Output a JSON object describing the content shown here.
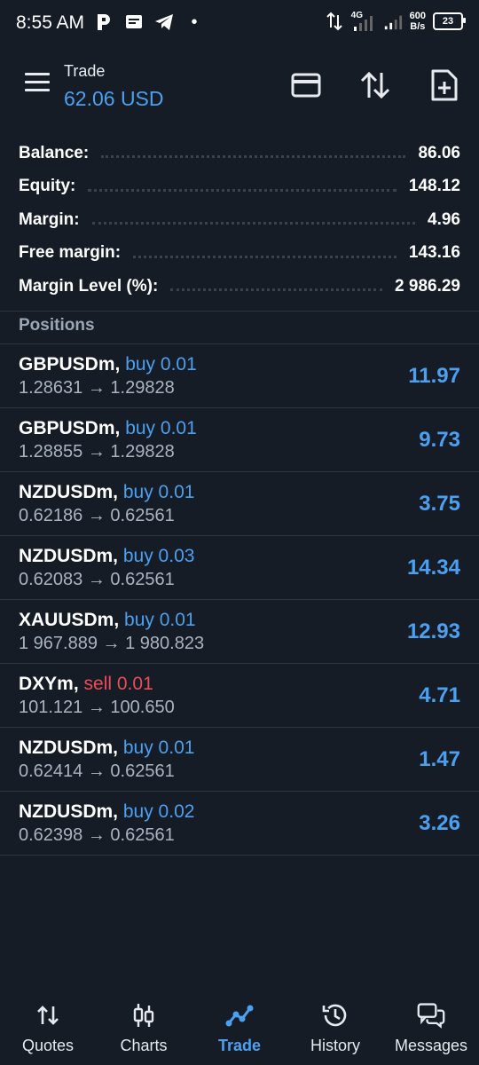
{
  "status_bar": {
    "time": "8:55 AM",
    "network_type": "4G",
    "speed_value": "600",
    "speed_unit": "B/s",
    "battery": "23",
    "dot": "•"
  },
  "header": {
    "title": "Trade",
    "subtitle": "62.06 USD"
  },
  "summary": [
    {
      "label": "Balance:",
      "value": "86.06"
    },
    {
      "label": "Equity:",
      "value": "148.12"
    },
    {
      "label": "Margin:",
      "value": "4.96"
    },
    {
      "label": "Free margin:",
      "value": "143.16"
    },
    {
      "label": "Margin Level (%):",
      "value": "2 986.29"
    }
  ],
  "positions_label": "Positions",
  "positions": [
    {
      "symbol": "GBPUSDm,",
      "side": "buy 0.01",
      "open": "1.28631",
      "arrow": "→",
      "current": "1.29828",
      "profit": "11.97",
      "type": "buy"
    },
    {
      "symbol": "GBPUSDm,",
      "side": "buy 0.01",
      "open": "1.28855",
      "arrow": "→",
      "current": "1.29828",
      "profit": "9.73",
      "type": "buy"
    },
    {
      "symbol": "NZDUSDm,",
      "side": "buy 0.01",
      "open": "0.62186",
      "arrow": "→",
      "current": "0.62561",
      "profit": "3.75",
      "type": "buy"
    },
    {
      "symbol": "NZDUSDm,",
      "side": "buy 0.03",
      "open": "0.62083",
      "arrow": "→",
      "current": "0.62561",
      "profit": "14.34",
      "type": "buy"
    },
    {
      "symbol": "XAUUSDm,",
      "side": "buy 0.01",
      "open": "1 967.889",
      "arrow": "→",
      "current": "1 980.823",
      "profit": "12.93",
      "type": "buy"
    },
    {
      "symbol": "DXYm,",
      "side": "sell 0.01",
      "open": "101.121",
      "arrow": "→",
      "current": "100.650",
      "profit": "4.71",
      "type": "sell"
    },
    {
      "symbol": "NZDUSDm,",
      "side": "buy 0.01",
      "open": "0.62414",
      "arrow": "→",
      "current": "0.62561",
      "profit": "1.47",
      "type": "buy"
    },
    {
      "symbol": "NZDUSDm,",
      "side": "buy 0.02",
      "open": "0.62398",
      "arrow": "→",
      "current": "0.62561",
      "profit": "3.26",
      "type": "buy"
    }
  ],
  "nav": [
    {
      "label": "Quotes",
      "icon": "quotes-icon"
    },
    {
      "label": "Charts",
      "icon": "charts-icon"
    },
    {
      "label": "Trade",
      "icon": "trade-icon",
      "active": true
    },
    {
      "label": "History",
      "icon": "history-icon"
    },
    {
      "label": "Messages",
      "icon": "messages-icon"
    }
  ],
  "colors": {
    "background": "#151c26",
    "accent": "#4ba0f2",
    "sell": "#f04b55",
    "muted": "#a9b4c1"
  }
}
